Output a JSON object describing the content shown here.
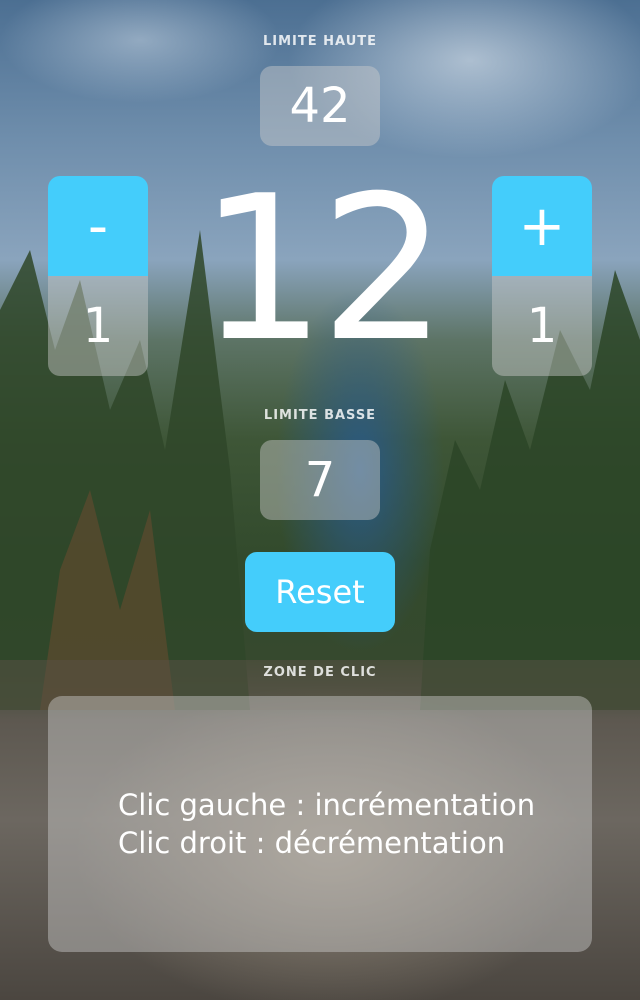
{
  "colors": {
    "accent": "#44cdfb",
    "panel": "rgba(205,205,205,0.45)",
    "text": "#ffffff"
  },
  "upper_limit": {
    "label": "LIMITE HAUTE",
    "value": "42"
  },
  "counter": {
    "value": "12"
  },
  "decrement": {
    "symbol": "-",
    "step": "1"
  },
  "increment": {
    "symbol": "+",
    "step": "1"
  },
  "lower_limit": {
    "label": "LIMITE BASSE",
    "value": "7"
  },
  "reset": {
    "label": "Reset"
  },
  "click_zone": {
    "label": "ZONE DE CLIC",
    "line1": "Clic gauche : incrémentation",
    "line2": "Clic droit : décrémentation"
  }
}
